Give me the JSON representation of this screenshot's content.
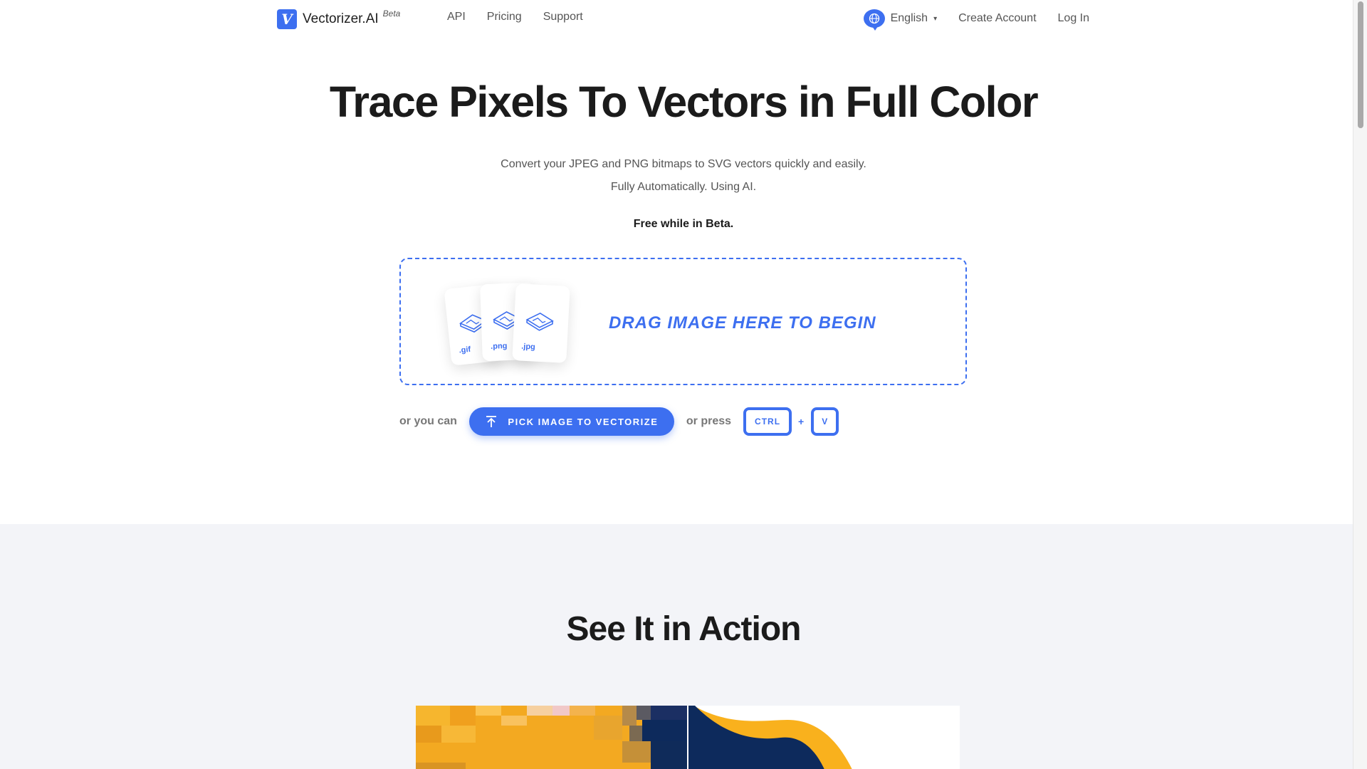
{
  "brand": {
    "name": "Vectorizer.AI",
    "beta": "Beta",
    "logo_glyph": "V"
  },
  "nav": {
    "links": [
      "API",
      "Pricing",
      "Support"
    ],
    "language": "English",
    "create_account": "Create Account",
    "log_in": "Log In"
  },
  "hero": {
    "title": "Trace Pixels To Vectors in Full Color",
    "subtitle_line1": "Convert your JPEG and PNG bitmaps to SVG vectors quickly and easily.",
    "subtitle_line2": "Fully Automatically. Using AI.",
    "beta_note": "Free while in Beta."
  },
  "upload": {
    "drop_text": "DRAG IMAGE HERE TO BEGIN",
    "file_types": [
      ".gif",
      ".png",
      ".jpg"
    ],
    "or_you_can": "or you can",
    "pick_button": "PICK IMAGE TO VECTORIZE",
    "or_press": "or press",
    "key_ctrl": "CTRL",
    "plus": "+",
    "key_v": "V"
  },
  "section2": {
    "title": "See It in Action"
  },
  "colors": {
    "accent": "#3d6ff0",
    "demo_yellow": "#f9b11d",
    "demo_navy": "#0d2a5c"
  },
  "icons": [
    "globe-icon",
    "upload-arrow-icon",
    "image-file-icon"
  ]
}
